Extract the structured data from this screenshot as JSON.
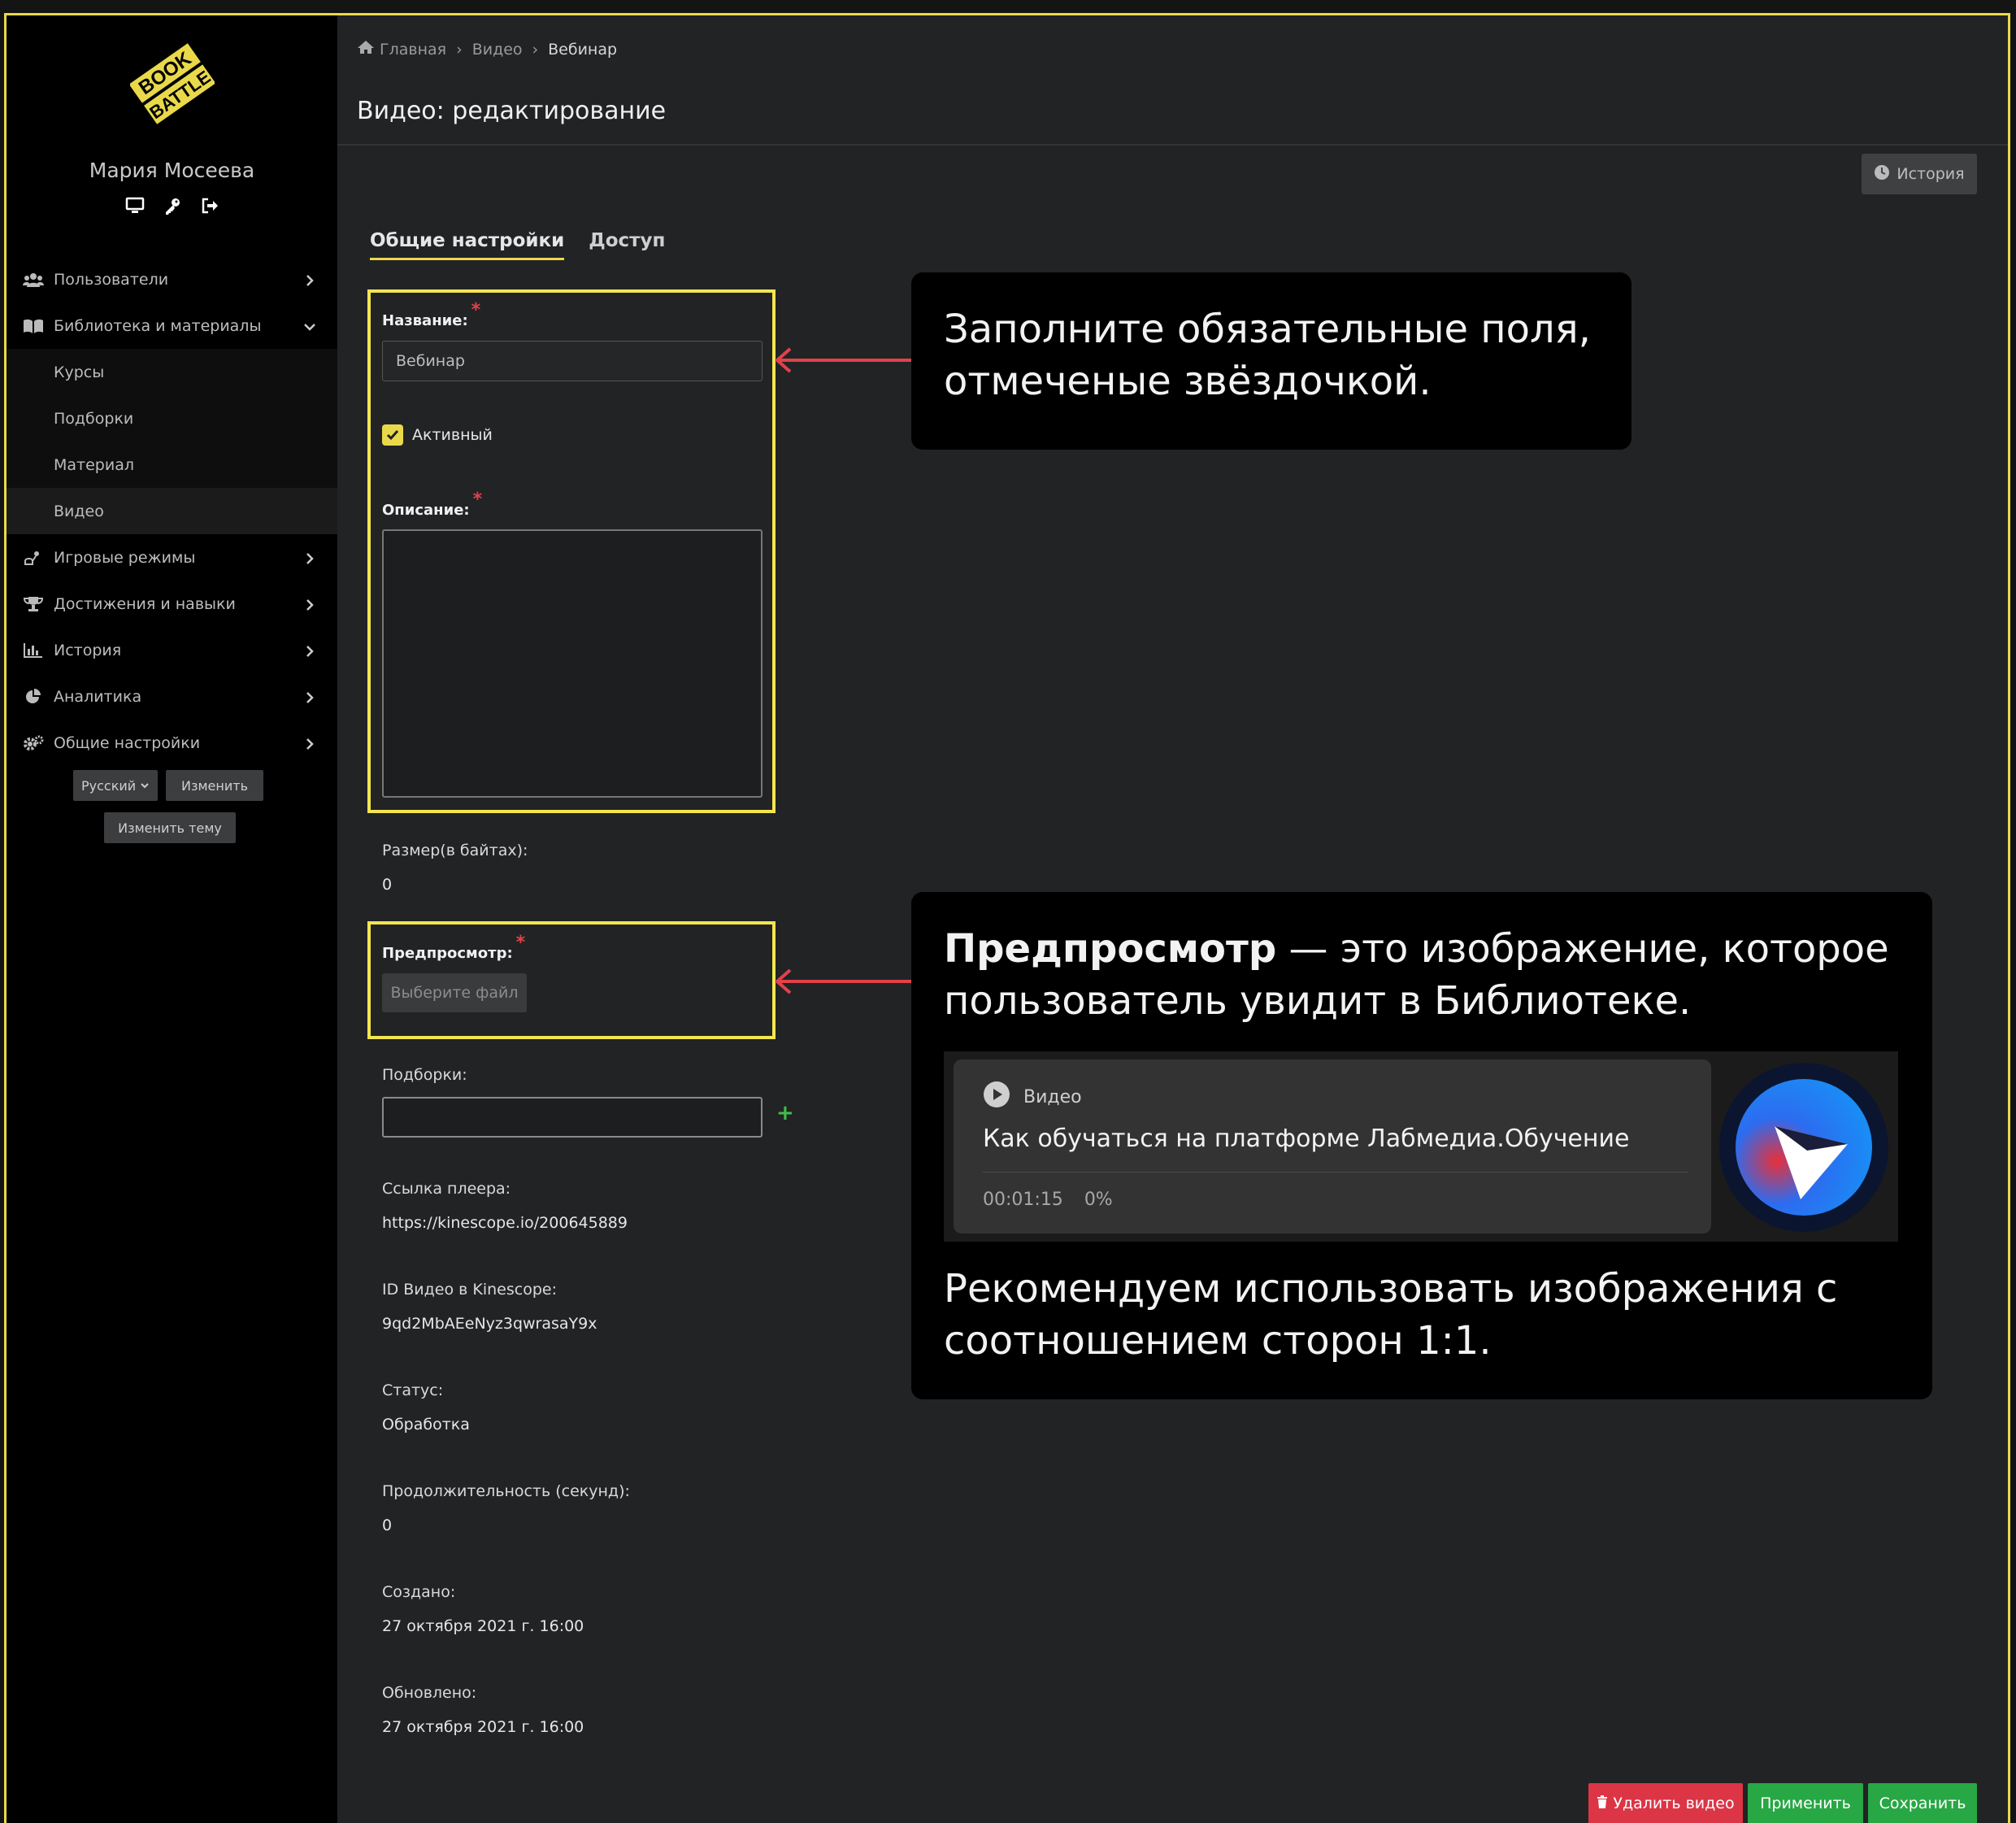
{
  "colors": {
    "accent": "#e9d94a",
    "required": "#e0424a",
    "danger": "#dc3545",
    "success": "#28a745",
    "arrow": "#e0424a"
  },
  "sidebar": {
    "logo_alt": "BOOKBATTLE",
    "user_name": "Мария Мосеева",
    "user_icons": [
      "monitor-icon",
      "key-icon",
      "sign-out-icon"
    ],
    "nav": {
      "users": "Пользователи",
      "library": "Библиотека и материалы",
      "sub": {
        "courses": "Курсы",
        "collections": "Подборки",
        "material": "Материал",
        "video": "Видео"
      },
      "game_modes": "Игровые режимы",
      "achievements": "Достижения и навыки",
      "history": "История",
      "analytics": "Аналитика",
      "settings": "Общие настройки"
    },
    "language": {
      "selected": "Русский",
      "change_label": "Изменить",
      "theme_label": "Изменить тему"
    }
  },
  "header": {
    "breadcrumb": {
      "home": "Главная",
      "section": "Видео",
      "current": "Вебинар"
    },
    "title": "Видео: редактирование",
    "history_label": "История"
  },
  "tabs": {
    "general": "Общие настройки",
    "access": "Доступ"
  },
  "form": {
    "name": {
      "label": "Название:",
      "required": "*",
      "value": "Вебинар"
    },
    "active": {
      "label": "Активный",
      "checked": true
    },
    "description": {
      "label": "Описание:",
      "required": "*",
      "value": ""
    },
    "size": {
      "label": "Размер(в байтах):",
      "value": "0"
    },
    "preview": {
      "label": "Предпросмотр:",
      "required": "*",
      "button": "Выберите файл"
    },
    "collections": {
      "label": "Подборки:",
      "value": "",
      "add": "+"
    },
    "player_link": {
      "label": "Ссылка плеера:",
      "value": "https://kinescope.io/200645889"
    },
    "kinescope_id": {
      "label": "ID Видео в Kinescope:",
      "value": "9qd2MbAEeNyz3qwrasaY9x"
    },
    "status": {
      "label": "Статус:",
      "value": "Обработка"
    },
    "duration": {
      "label": "Продолжительность (секунд):",
      "value": "0"
    },
    "created": {
      "label": "Создано:",
      "value": "27 октября 2021 г. 16:00"
    },
    "updated": {
      "label": "Обновлено:",
      "value": "27 октября 2021 г. 16:00"
    }
  },
  "callouts": {
    "required_fields": {
      "line1": "Заполните обязательные поля,",
      "line2": "отмеченые звёздочкой."
    },
    "preview": {
      "bold": "Предпросмотр",
      "rest1": " — это изображение, которое",
      "line2": "пользователь увидит в Библиотеке.",
      "card": {
        "category": "Видео",
        "title": "Как обучаться на платформе Лабмедиа.Обучение",
        "time": "00:01:15",
        "progress": "0%"
      },
      "rec_line1": "Рекомендуем использовать изображения с",
      "rec_line2": "соотношением сторон 1:1."
    }
  },
  "actions": {
    "delete": "Удалить видео",
    "apply": "Применить",
    "save": "Сохранить"
  }
}
